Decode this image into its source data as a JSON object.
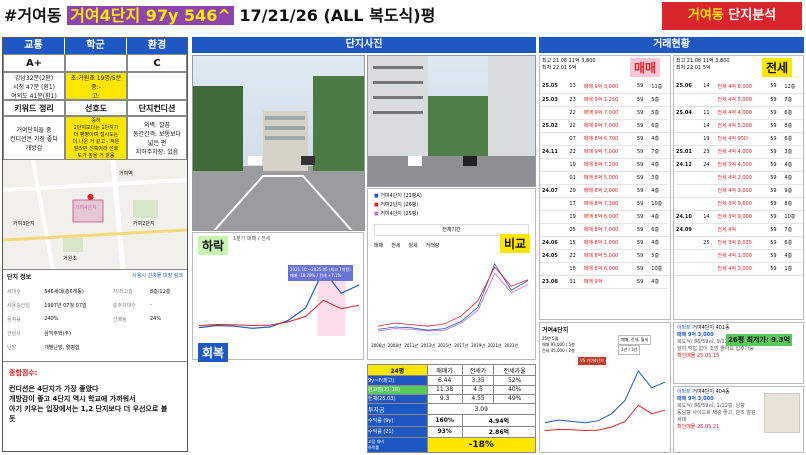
{
  "header": {
    "prefix": "#거여동",
    "highlight": "거여4단지 97y 546^",
    "suffix": "17/21/26 (ALL 복도식)평",
    "badge_region": "거여동",
    "badge_label": "단지분석"
  },
  "info_panel": {
    "headers": [
      "교통",
      "학군",
      "환경"
    ],
    "grades": [
      "A+",
      "",
      "C"
    ],
    "traffic": "강남32분(2환)\n시청 47분 (환1)\n여의도 41분(환1)",
    "school": "초:거원초 19명/5분\n중:-\n고:",
    "keyword_headers": [
      "키워드 정리",
      "선호도",
      "단지컨디션"
    ],
    "keyword_text": "거여단지들 중\n컨디션은 가장 좋다\n개방감",
    "preference_text": "중하\n2단지보다는 1단지가\n더 평평이며 접시도는\n더 나은 거 같고 - 적은\n빌라만 신축이라 선호\n도가 높을 거 같음",
    "condition_text": "외벽: 깔끔\n동간간격: 보통보다\n넓은 편\n지하주차장: 있음",
    "map_labels": [
      "거여4단지",
      "거여역",
      "거원초",
      "거여2단지",
      "거여3단지"
    ],
    "complex_title": "단지 정보",
    "complex_link": "사용시 건축물 대장 링크",
    "complex_rows": [
      {
        "k": "세대수",
        "v": "546세대(총6개동)",
        "k2": "저/최고층",
        "v2": "8층/12층"
      },
      {
        "k": "사용승인일",
        "v": "1997년 07월 07일",
        "k2": "총주차대수",
        "v2": "-"
      },
      {
        "k": "용적률",
        "v": "240%",
        "k2": "건폐율",
        "v2": "24%"
      },
      {
        "k": "건설사",
        "v": "삼익주택(주)",
        "k2": "",
        "v2": ""
      },
      {
        "k": "난방",
        "v": "개별난방, 열병합",
        "k2": "",
        "v2": ""
      }
    ],
    "summary_title": "종합점수:",
    "summary_text": "컨디션은 4단지가 가장 좋았다\n개방감이 좋고 4단지 역시 학교에 가까워서\n아기 키우는 입장에서는 1,2 단지보다 더 우선으로 볼\n듯"
  },
  "photos": {
    "header": "단지사진",
    "low_label": "하락",
    "recover_label": "회복",
    "compare_label": "비교",
    "chart_card_title": "1분기 매매 / 전세",
    "chart_card_sub": "2021.10.~2025.05 (최고 7억원)\n매매 -18.28% / 전세 +7.1%",
    "compare_legend": [
      "거여4단지 (21평A)",
      "거여2단지 (26평)",
      "거여4단지 (25평)"
    ],
    "compare_button": "전체기간",
    "compare_tabs": [
      "매매",
      "전세",
      "월세",
      "거래량"
    ],
    "compare_years": [
      "2006년",
      "2008년",
      "2011년",
      "2013년",
      "2015년",
      "2017년",
      "2019년",
      "2021년",
      "2023년"
    ]
  },
  "compare_table": {
    "headers": [
      "24평",
      "매매가",
      "전세가",
      "전세가율"
    ],
    "rows": [
      {
        "label": "9y~F(최고)",
        "a": "6.44",
        "b": "3.35",
        "c": "52%"
      },
      {
        "label": "현고점(21.10)",
        "a": "11.38",
        "b": "4.5",
        "c": "40%"
      },
      {
        "label": "현재(25.03)",
        "a": "9.3",
        "b": "4.55",
        "c": "49%"
      }
    ],
    "invest_label": "투자금",
    "invest_value": "3.09",
    "ret1_label": "수익률 (9y)",
    "ret1_a": "160%",
    "ret1_b": "4.94억",
    "ret2_label": "수익률 (21)",
    "ret2_a": "93%",
    "ret2_b": "2.86억",
    "drop_label": "고점 대비\n하락률",
    "drop_value": "-18%"
  },
  "trade": {
    "header": "거래현황",
    "sale_stamp": "매매",
    "rent_stamp": "전세",
    "sale_summary": "최고 21.08 11억 3,800\n최저 22.01 5억",
    "rent_summary": "최고 21.08 11억 3,800\n최저 22.01 5억",
    "sale_rows": [
      {
        "d": "25.05",
        "day": "13",
        "p": "매매 9억 3,000",
        "a": "59",
        "f": "11층"
      },
      {
        "d": "25.03",
        "day": "23",
        "p": "매매 9억 1,250",
        "a": "59",
        "f": "5층"
      },
      {
        "d": "",
        "day": "22",
        "p": "매매 9억 7,000",
        "a": "59",
        "f": "5층"
      },
      {
        "d": "25.02",
        "day": "22",
        "p": "매매 9억 7,000",
        "a": "59",
        "f": "6층"
      },
      {
        "d": "",
        "day": "07",
        "p": "매매 8억 6,700",
        "a": "59",
        "f": "4층"
      },
      {
        "d": "24.11",
        "day": "22",
        "p": "매매 9억 7,000",
        "a": "59",
        "f": "7층"
      },
      {
        "d": "",
        "day": "19",
        "p": "매매 8억 7,200",
        "a": "59",
        "f": "4층"
      },
      {
        "d": "",
        "day": "01",
        "p": "매매 8억 5,000",
        "a": "59",
        "f": "3층"
      },
      {
        "d": "24.07",
        "day": "29",
        "p": "매매 8억 2,000",
        "a": "59",
        "f": "4층"
      },
      {
        "d": "",
        "day": "17",
        "p": "매매 8억 7,300",
        "a": "59",
        "f": "10층"
      },
      {
        "d": "",
        "day": "19",
        "p": "매매 8억 8,000",
        "a": "59",
        "f": "4층"
      },
      {
        "d": "",
        "day": "05",
        "p": "매매 8억 7,000",
        "a": "59",
        "f": "6층"
      },
      {
        "d": "24.06",
        "day": "15",
        "p": "매매 8억 1,000",
        "a": "59",
        "f": "4층"
      },
      {
        "d": "24.05",
        "day": "22",
        "p": "매매 8억 5,000",
        "a": "59",
        "f": "5층"
      },
      {
        "d": "",
        "day": "18",
        "p": "매매 8억 6,000",
        "a": "59",
        "f": "10층"
      },
      {
        "d": "23.08",
        "day": "31",
        "p": "매매 9억",
        "a": "59",
        "f": "4층"
      }
    ],
    "rent_rows": [
      {
        "d": "25.06",
        "day": "14",
        "p": "전세 4억 8,000",
        "a": "59",
        "f": "12층"
      },
      {
        "d": "",
        "day": "",
        "p": "전세 4억 5,000",
        "a": "59",
        "f": "7층"
      },
      {
        "d": "25.04",
        "day": "11",
        "p": "전세 4억 4,000",
        "a": "59",
        "f": "6층"
      },
      {
        "d": "",
        "day": "14",
        "p": "전세 4억 5,000",
        "a": "59",
        "f": "8층"
      },
      {
        "d": "",
        "day": "19",
        "p": "전세 4억 95D",
        "a": "59",
        "f": "6층"
      },
      {
        "d": "25.01",
        "day": "23",
        "p": "전세 4억 4,000",
        "a": "59",
        "f": "3층"
      },
      {
        "d": "24.12",
        "day": "24",
        "p": "전세 3억 4,000",
        "a": "59",
        "f": "4층"
      },
      {
        "d": "",
        "day": "",
        "p": "전세 4억 2,000",
        "a": "59",
        "f": "4층"
      },
      {
        "d": "",
        "day": "",
        "p": "전세 4억 3,000",
        "a": "59",
        "f": "9층"
      },
      {
        "d": "",
        "day": "",
        "p": "전세 3억 9,600",
        "a": "59",
        "f": "8층"
      },
      {
        "d": "24.10",
        "day": "14",
        "p": "전세 3억 9,000",
        "a": "59",
        "f": "10층"
      },
      {
        "d": "24.09",
        "day": "",
        "p": "전세 4억",
        "a": "59",
        "f": "7층"
      },
      {
        "d": "",
        "day": "25",
        "p": "전세 3억 8,035",
        "a": "59",
        "f": "6층"
      },
      {
        "d": "",
        "day": "",
        "p": "전세 4억 1,000",
        "a": "59",
        "f": "4층"
      },
      {
        "d": "",
        "day": "",
        "p": "전세 4억 3,000",
        "a": "59",
        "f": "1층"
      }
    ],
    "mini_title": "거여4단지",
    "mini_sub": "25년 5월\n매매 93,000 / 5층\n전세 45,000 / 2층",
    "mini_tabs": [
      "매매, 전세, 월세",
      "1년 / 3년"
    ],
    "mini_tooltip": "VS 거여4단지",
    "listing1_tag": "아파트",
    "listing1_title": "거여4단지 401동",
    "listing1_badge": "26평 최저가: 9.3억",
    "listing1_price": "매매 9억 3,000",
    "listing1_desc": "복도식/ 86/59㎡, 9/12층, 남서향\n앞이 막힘 없이 조망 좋아요 입주가능",
    "listing1_date": "확인매물 25.05.15",
    "listing2_tag": "아파트",
    "listing2_title": "거여4단지 404동",
    "listing2_price": "매매 9억 3,000",
    "listing2_desc": "복도식/ 86/59㎡, 1/12층, 남향\n동남향 사이드로 채광 좋고, 관리 잘된 세대",
    "listing2_date": "확인매물 25.05.21"
  },
  "chart_data": [
    {
      "type": "line",
      "title": "1분기 매매 / 전세",
      "x": [
        "2006년",
        "2008년",
        "2011년",
        "2013년",
        "2015년",
        "2017년",
        "2019년",
        "2021년",
        "2023년",
        "2025년"
      ],
      "series": [
        {
          "name": "거여4단지 (21평A)",
          "values": [
            3.2,
            3.5,
            3.4,
            3.1,
            3.3,
            4.2,
            6.0,
            11.4,
            8.1,
            9.3
          ]
        },
        {
          "name": "거여2단지 (26평)",
          "values": [
            3.6,
            4.0,
            3.8,
            3.6,
            3.9,
            4.9,
            6.8,
            11.0,
            8.6,
            9.4
          ]
        },
        {
          "name": "거여4단지 (25평)",
          "values": [
            3.0,
            3.3,
            3.2,
            3.0,
            3.1,
            4.0,
            5.6,
            10.2,
            7.8,
            8.8
          ]
        }
      ],
      "colors": [
        "#1f57c3",
        "#d8262c",
        "#c46fd0"
      ]
    }
  ]
}
